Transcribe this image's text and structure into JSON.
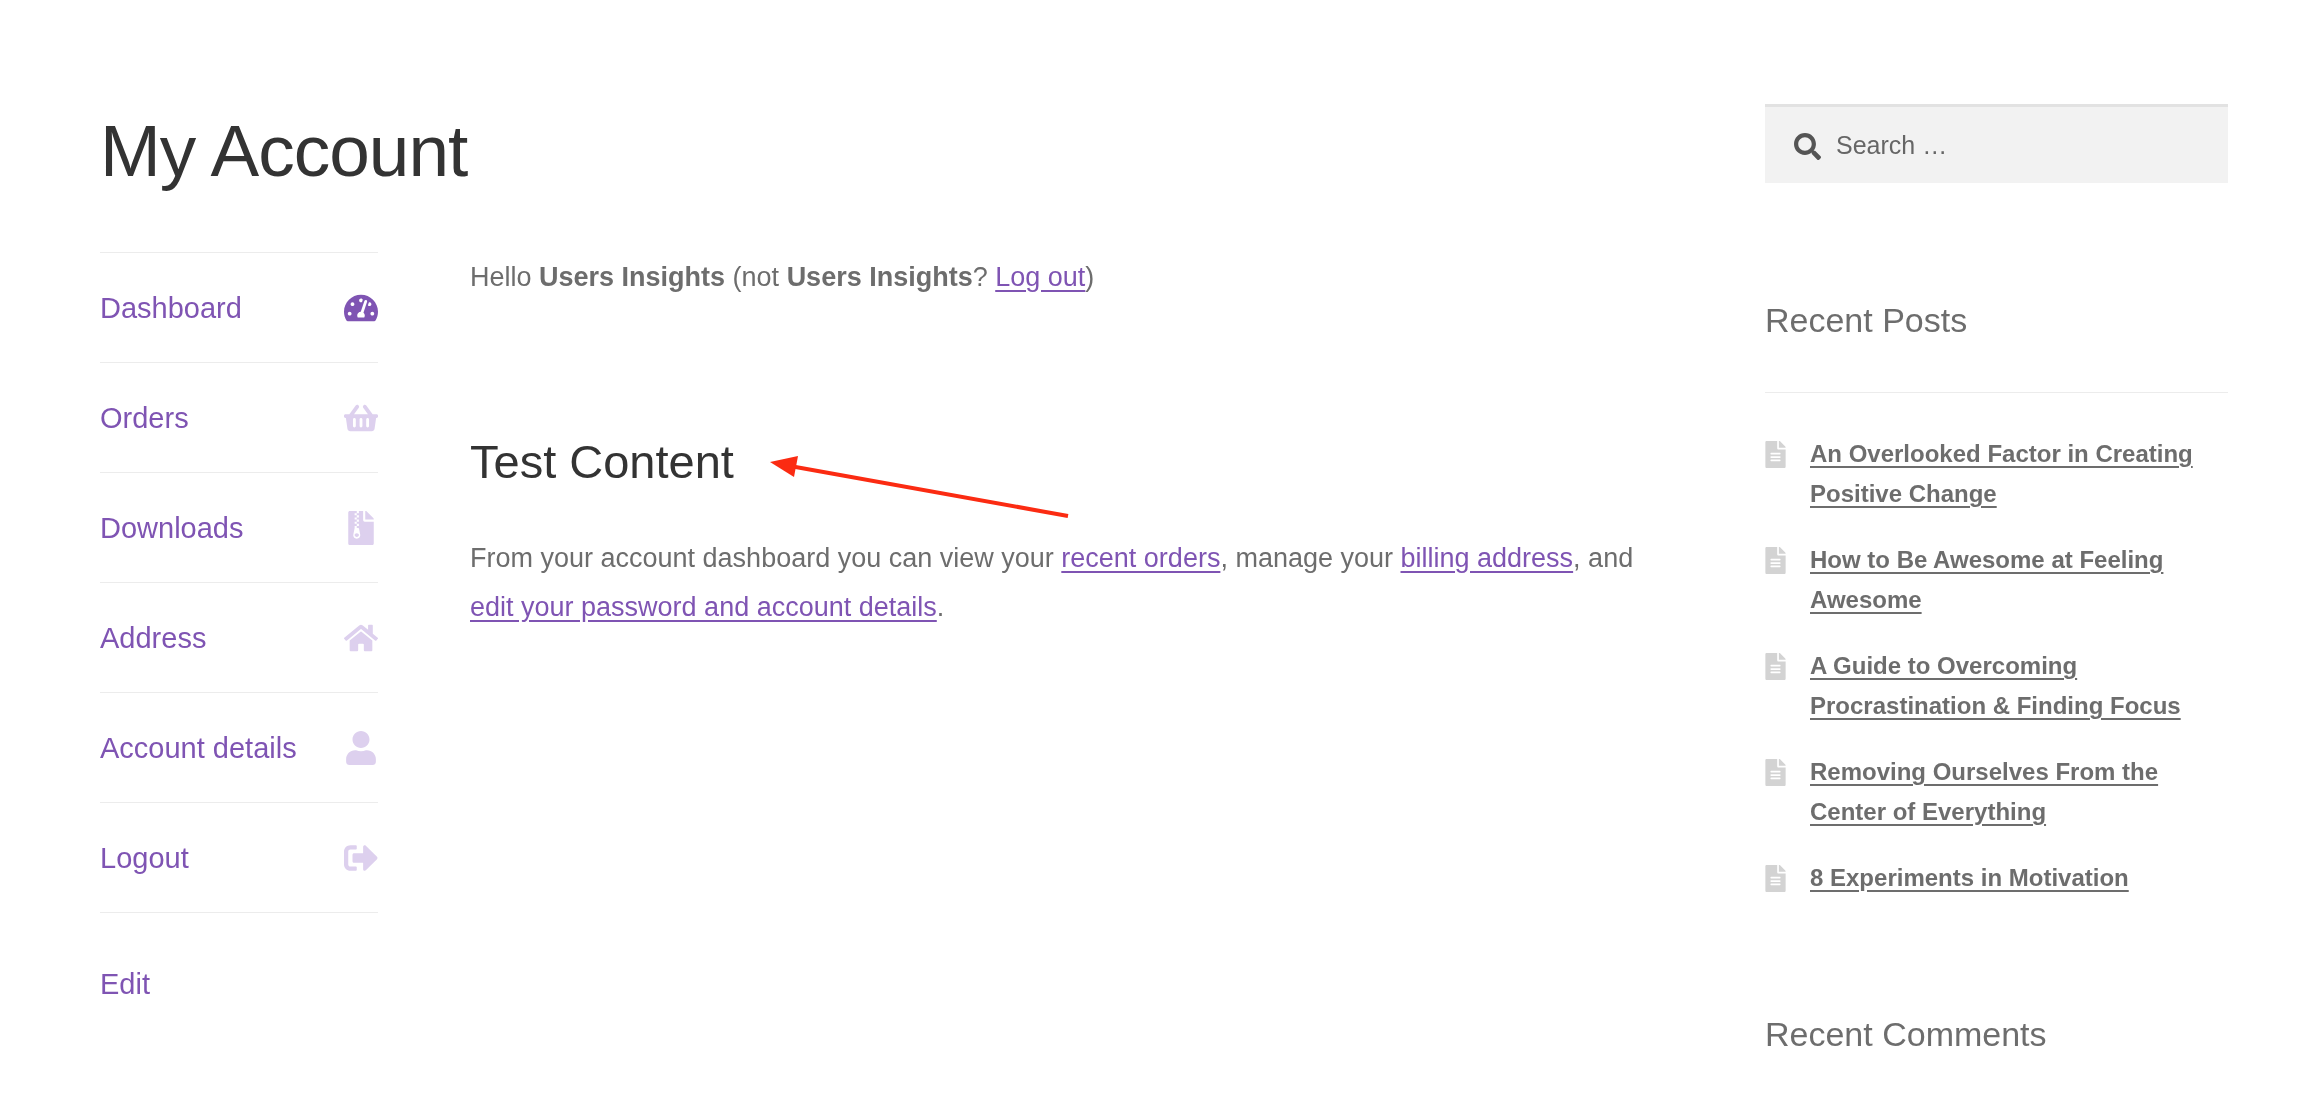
{
  "page": {
    "title": "My Account"
  },
  "account_nav": {
    "items": [
      {
        "kind": "dashboard",
        "label": "Dashboard",
        "selected": true
      },
      {
        "kind": "orders",
        "label": "Orders",
        "selected": false
      },
      {
        "kind": "downloads",
        "label": "Downloads",
        "selected": false
      },
      {
        "kind": "address",
        "label": "Address",
        "selected": false
      },
      {
        "kind": "account",
        "label": "Account details",
        "selected": false
      },
      {
        "kind": "logout",
        "label": "Logout",
        "selected": false
      }
    ],
    "edit_link": "Edit"
  },
  "content": {
    "greeting": [
      {
        "kind": "text",
        "text": "Hello **Users Insights** (not **Users Insights**? "
      },
      {
        "kind": "link",
        "text": "Log out"
      },
      {
        "kind": "text",
        "text": ")"
      }
    ],
    "heading": "Test Content",
    "intro": [
      {
        "kind": "text",
        "text": "From your account dashboard you can view your "
      },
      {
        "kind": "link",
        "text": "recent orders"
      },
      {
        "kind": "text",
        "text": ", manage your "
      },
      {
        "kind": "link",
        "text": "billing address"
      },
      {
        "kind": "text",
        "text": ", and "
      },
      {
        "kind": "link",
        "text": "edit your password and account details"
      },
      {
        "kind": "text",
        "text": "."
      }
    ]
  },
  "sidebar": {
    "search": {
      "placeholder": "Search …"
    },
    "recent_posts": {
      "title": "Recent Posts",
      "items": [
        "An Overlooked Factor in Creating Positive Change",
        "How to Be Awesome at Feeling Awesome",
        "A Guide to Overcoming Procrastination & Finding Focus",
        "Removing Ourselves From the Center of Everything",
        "8 Experiments in Motivation"
      ]
    },
    "recent_comments": {
      "title": "Recent Comments"
    }
  }
}
